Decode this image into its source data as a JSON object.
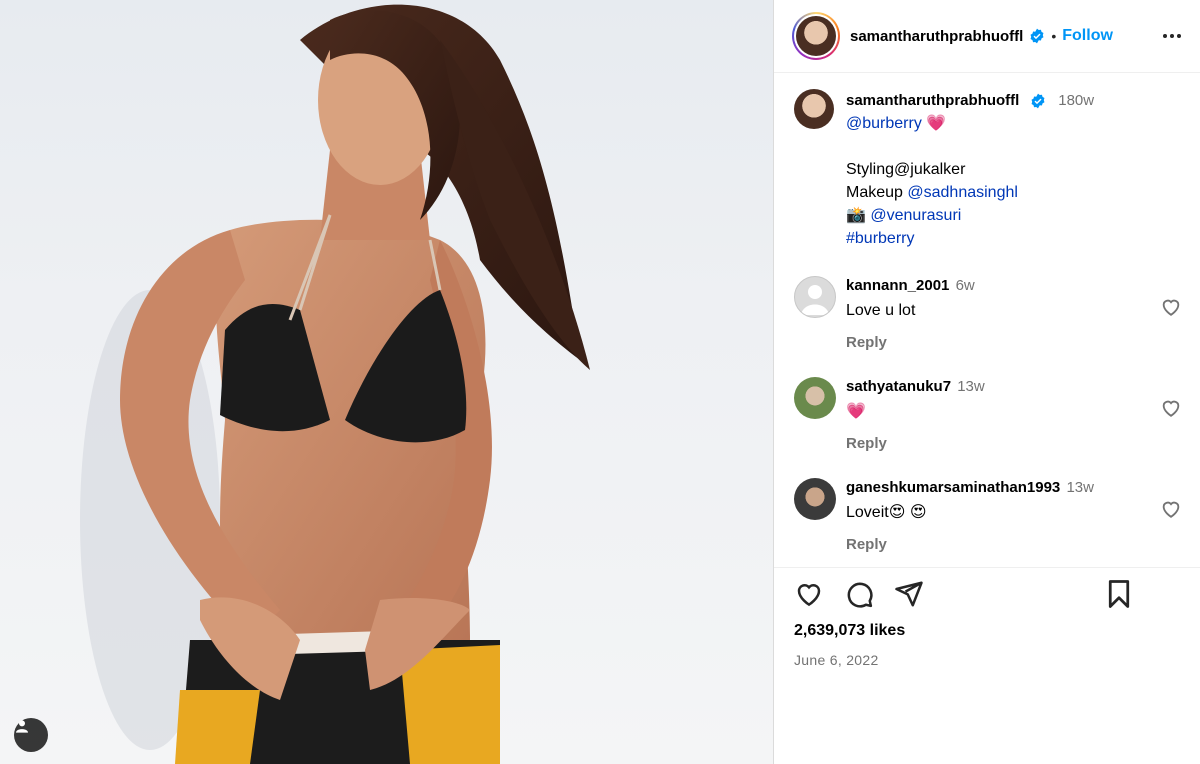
{
  "post": {
    "author": "samantharuthprabhuoffl",
    "follow_label": "Follow",
    "separator": "•",
    "likes_text": "2,639,073 likes",
    "date": "June 6, 2022"
  },
  "caption": {
    "username": "samantharuthprabhuoffl",
    "time": "180w",
    "line1_link": "@burberry",
    "line1_emoji": "💗",
    "styling_text": "Styling@jukalker",
    "makeup_prefix": "Makeup",
    "makeup_link": "@sadhnasinghl",
    "camera_emoji": "📸",
    "photo_link": "@venurasuri",
    "hashtag": "#burberry"
  },
  "comments": [
    {
      "username": "kannann_2001",
      "time": "6w",
      "text": "Love u lot",
      "reply": "Reply"
    },
    {
      "username": "sathyatanuku7",
      "time": "13w",
      "text": "💗",
      "reply": "Reply"
    },
    {
      "username": "ganeshkumarsaminathan1993",
      "time": "13w",
      "text": "Loveit😍 😍",
      "reply": "Reply"
    }
  ],
  "colors": {
    "link": "#0037b6",
    "follow": "#0095f6",
    "verified": "#0095f6",
    "muted": "#737373",
    "heart": "#ed4956"
  },
  "icons": {
    "verified": "verified-badge-icon",
    "more": "more-options-icon",
    "like": "heart-icon",
    "comment": "comment-icon",
    "share": "paper-plane-icon",
    "save": "bookmark-icon",
    "tag": "user-tag-icon"
  }
}
